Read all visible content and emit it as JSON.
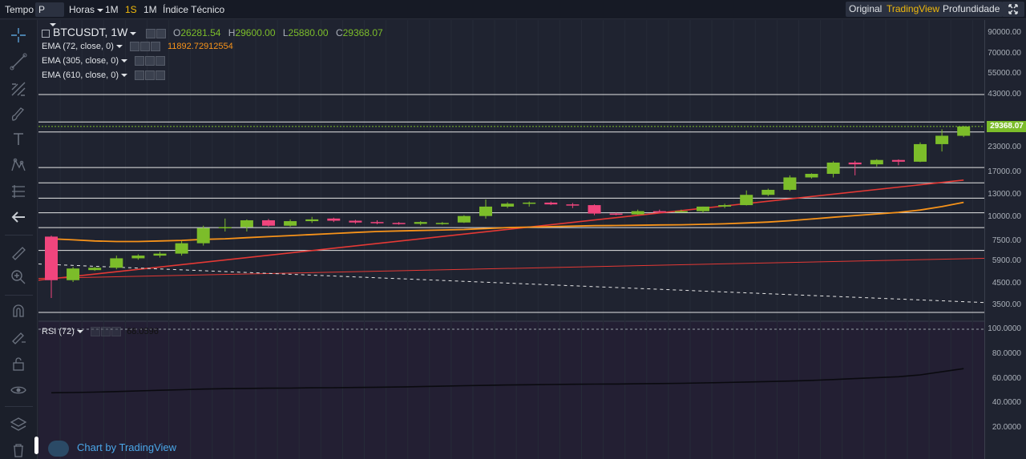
{
  "toolbar": {
    "tempo": "Tempo",
    "period": "P",
    "horas": "Horas",
    "intervals": [
      "1M",
      "1S",
      "1M"
    ],
    "active_interval": 1,
    "indicators": "Índice Técnico",
    "views": [
      "Original",
      "TradingView",
      "Profundidade"
    ],
    "active_view": 1
  },
  "legend": {
    "symbol": "BTCUSDT, 1W",
    "ohlc": [
      {
        "key": "O",
        "value": "26281.54"
      },
      {
        "key": "H",
        "value": "29600.00"
      },
      {
        "key": "L",
        "value": "25880.00"
      },
      {
        "key": "C",
        "value": "29368.07"
      }
    ],
    "ema1": "EMA (72, close, 0)",
    "ema1_value": "11892.72912554",
    "ema2": "EMA (305, close, 0)",
    "ema3": "EMA (610, close, 0)",
    "rsi": "RSI (72)",
    "rsi_value": "68.0596"
  },
  "price_axis": [
    "90000.00",
    "70000.00",
    "55000.00",
    "43000.00",
    "23000.00",
    "17000.00",
    "13000.00",
    "10000.00",
    "7500.00",
    "5900.00",
    "4500.00",
    "3500.00"
  ],
  "last_price": "29368.07",
  "rsi_axis": [
    "100.0000",
    "80.0000",
    "60.0000",
    "40.0000",
    "20.0000"
  ],
  "watermark": "Chart by TradingView",
  "colors": {
    "up": "#7cbd2a",
    "down": "#f0457d",
    "ema72": "#f7931a",
    "trendline": "#e53935",
    "accent": "#f0b90b",
    "link": "#4aa7e8"
  },
  "chart_data": {
    "type": "candlestick",
    "title": "BTCUSDT, 1W",
    "scale": "log",
    "ylim": [
      3200,
      95000
    ],
    "candles": [
      {
        "o": 7900,
        "h": 8000,
        "l": 3800,
        "c": 4700
      },
      {
        "o": 4700,
        "h": 5500,
        "l": 4600,
        "c": 5400
      },
      {
        "o": 5300,
        "h": 5500,
        "l": 5250,
        "c": 5450
      },
      {
        "o": 5450,
        "h": 6300,
        "l": 5350,
        "c": 6100
      },
      {
        "o": 6100,
        "h": 6400,
        "l": 6000,
        "c": 6300
      },
      {
        "o": 6300,
        "h": 6600,
        "l": 6150,
        "c": 6450
      },
      {
        "o": 6450,
        "h": 7500,
        "l": 6300,
        "c": 7300
      },
      {
        "o": 7300,
        "h": 9000,
        "l": 7100,
        "c": 8750
      },
      {
        "o": 8750,
        "h": 9800,
        "l": 8400,
        "c": 8850
      },
      {
        "o": 8850,
        "h": 9700,
        "l": 8400,
        "c": 9600
      },
      {
        "o": 9600,
        "h": 9750,
        "l": 8900,
        "c": 9000
      },
      {
        "o": 9000,
        "h": 9700,
        "l": 8900,
        "c": 9500
      },
      {
        "o": 9500,
        "h": 10000,
        "l": 9300,
        "c": 9700
      },
      {
        "o": 9800,
        "h": 9900,
        "l": 9400,
        "c": 9550
      },
      {
        "o": 9550,
        "h": 9650,
        "l": 9200,
        "c": 9350
      },
      {
        "o": 9400,
        "h": 9600,
        "l": 9150,
        "c": 9300
      },
      {
        "o": 9300,
        "h": 9400,
        "l": 9100,
        "c": 9200
      },
      {
        "o": 9200,
        "h": 9500,
        "l": 9050,
        "c": 9400
      },
      {
        "o": 9250,
        "h": 9400,
        "l": 9100,
        "c": 9300
      },
      {
        "o": 9350,
        "h": 10200,
        "l": 9300,
        "c": 10100
      },
      {
        "o": 10100,
        "h": 12300,
        "l": 9800,
        "c": 11300
      },
      {
        "o": 11300,
        "h": 11900,
        "l": 11100,
        "c": 11700
      },
      {
        "o": 11700,
        "h": 12000,
        "l": 11300,
        "c": 11850
      },
      {
        "o": 11850,
        "h": 12000,
        "l": 11500,
        "c": 11600
      },
      {
        "o": 11600,
        "h": 11800,
        "l": 11100,
        "c": 11500
      },
      {
        "o": 11500,
        "h": 11600,
        "l": 10200,
        "c": 10400
      },
      {
        "o": 10400,
        "h": 10500,
        "l": 10200,
        "c": 10300
      },
      {
        "o": 10300,
        "h": 10900,
        "l": 10250,
        "c": 10700
      },
      {
        "o": 10700,
        "h": 10900,
        "l": 10600,
        "c": 10650
      },
      {
        "o": 10650,
        "h": 10900,
        "l": 10550,
        "c": 10700
      },
      {
        "o": 10700,
        "h": 11300,
        "l": 10500,
        "c": 11300
      },
      {
        "o": 11300,
        "h": 11700,
        "l": 11100,
        "c": 11500
      },
      {
        "o": 11500,
        "h": 13700,
        "l": 11450,
        "c": 13000
      },
      {
        "o": 13000,
        "h": 14000,
        "l": 12800,
        "c": 13800
      },
      {
        "o": 13800,
        "h": 16400,
        "l": 13600,
        "c": 16000
      },
      {
        "o": 16000,
        "h": 16800,
        "l": 15800,
        "c": 16700
      },
      {
        "o": 16700,
        "h": 19400,
        "l": 16000,
        "c": 19100
      },
      {
        "o": 19100,
        "h": 19500,
        "l": 16400,
        "c": 18700
      },
      {
        "o": 18700,
        "h": 19900,
        "l": 18200,
        "c": 19700
      },
      {
        "o": 19700,
        "h": 19850,
        "l": 18500,
        "c": 19300
      },
      {
        "o": 19300,
        "h": 24300,
        "l": 19200,
        "c": 23800
      },
      {
        "o": 23800,
        "h": 28400,
        "l": 21800,
        "c": 26300
      },
      {
        "o": 26281.54,
        "h": 29600,
        "l": 25880,
        "c": 29368.07
      }
    ],
    "ema72": [
      7700,
      7600,
      7500,
      7450,
      7450,
      7500,
      7550,
      7650,
      7700,
      7800,
      7900,
      8000,
      8100,
      8200,
      8300,
      8400,
      8450,
      8500,
      8550,
      8600,
      8700,
      8800,
      8850,
      8900,
      8950,
      9000,
      9020,
      9050,
      9080,
      9100,
      9150,
      9200,
      9300,
      9400,
      9550,
      9750,
      9950,
      10150,
      10350,
      10550,
      10850,
      11300,
      11892.73
    ],
    "horizontal_levels": [
      43000,
      31000,
      27500,
      18000,
      15000,
      12500,
      10500,
      8800,
      6700,
      3200
    ],
    "rsi": [
      48.5,
      48.7,
      49,
      49.5,
      50,
      50.5,
      51,
      51.5,
      51.8,
      52,
      52.2,
      52.3,
      52.5,
      52.6,
      52.8,
      53,
      53.2,
      53.5,
      53.8,
      54.2,
      54.5,
      54.8,
      55,
      55.2,
      55.4,
      55.5,
      55.6,
      55.8,
      56,
      56.2,
      56.5,
      56.8,
      57.2,
      57.6,
      58,
      58.5,
      59.2,
      60,
      60.8,
      61.5,
      63,
      65.5,
      68.06
    ]
  }
}
